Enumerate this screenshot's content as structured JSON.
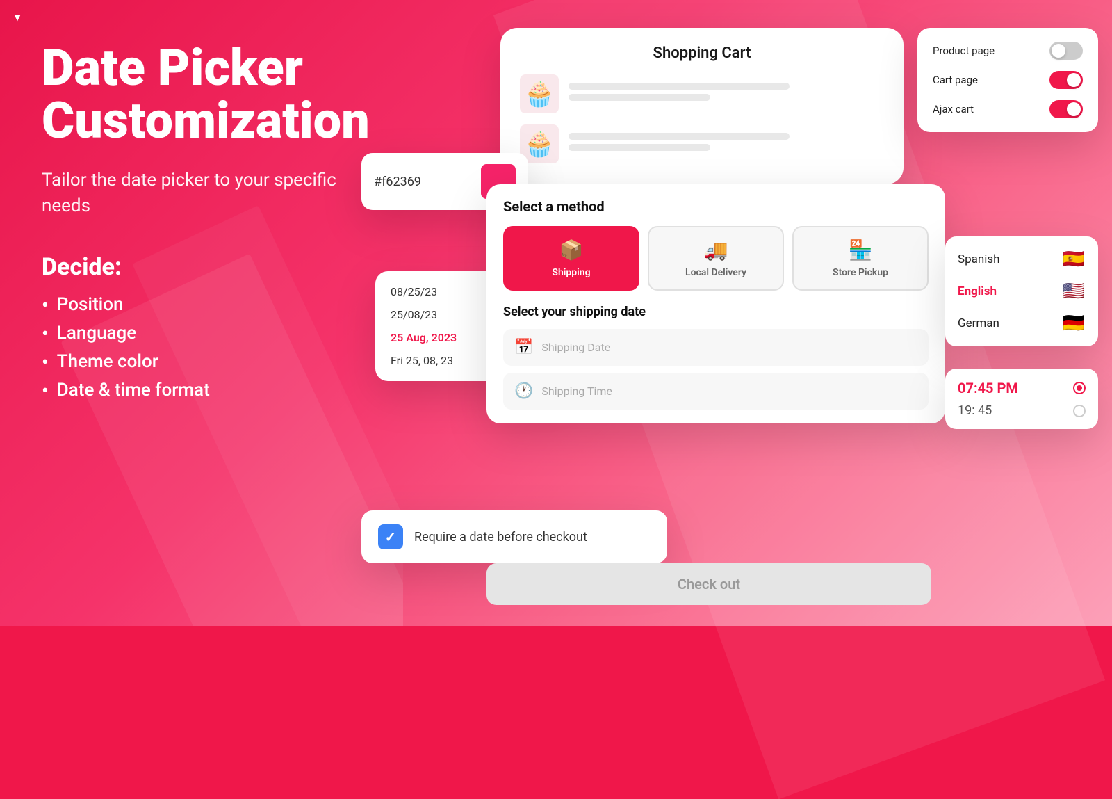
{
  "app": {
    "icon": "▼"
  },
  "left": {
    "title_line1": "Date Picker",
    "title_line2": "Customization",
    "subtitle": "Tailor the date picker to\nyour specific needs",
    "decide_title": "Decide:",
    "bullets": [
      "Position",
      "Language",
      "Theme color",
      "Date & time format"
    ]
  },
  "shopping_cart": {
    "title": "Shopping Cart",
    "items": [
      {
        "emoji": "🧁"
      },
      {
        "emoji": "🧁"
      }
    ]
  },
  "toggle_panel": {
    "items": [
      {
        "label": "Product page",
        "state": "off"
      },
      {
        "label": "Cart page",
        "state": "on"
      },
      {
        "label": "Ajax cart",
        "state": "on"
      }
    ]
  },
  "method_card": {
    "select_title": "Select a method",
    "methods": [
      {
        "label": "Shipping",
        "active": true,
        "icon": "📦"
      },
      {
        "label": "Local Delivery",
        "active": false,
        "icon": "🚚"
      },
      {
        "label": "Store Pickup",
        "active": false,
        "icon": "🏪"
      }
    ],
    "date_title": "Select your shipping date",
    "date_placeholder": "Shipping Date",
    "time_placeholder": "Shipping Time"
  },
  "lang_panel": {
    "languages": [
      {
        "name": "Spanish",
        "active": false,
        "flag": "🇪🇸"
      },
      {
        "name": "English",
        "active": true,
        "flag": "🇺🇸"
      },
      {
        "name": "German",
        "active": false,
        "flag": "🇩🇪"
      }
    ]
  },
  "time_panel": {
    "time1": "07:45 PM",
    "time2": "19: 45"
  },
  "date_format_card": {
    "formats": [
      {
        "value": "08/25/23",
        "active": false
      },
      {
        "value": "25/08/23",
        "active": false
      },
      {
        "value": "25 Aug, 2023",
        "active": true
      },
      {
        "value": "Fri 25, 08, 23",
        "active": false
      }
    ]
  },
  "color_card": {
    "hex": "#f62369",
    "color": "#f62369"
  },
  "checkbox_card": {
    "label": "Require a date before checkout"
  },
  "checkout_btn": {
    "label": "Check out"
  }
}
